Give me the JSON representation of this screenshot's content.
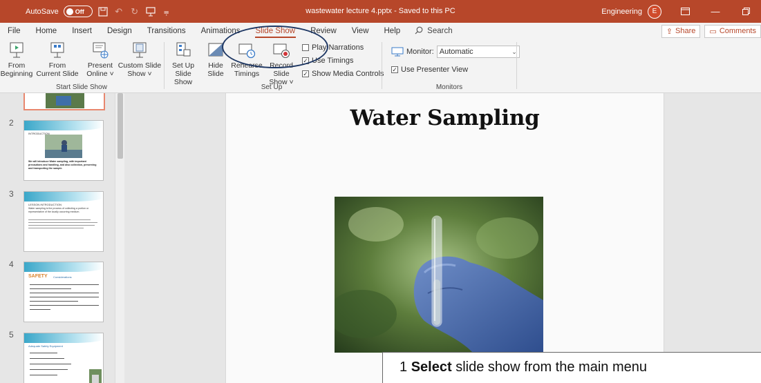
{
  "titlebar": {
    "autosave_label": "AutoSave",
    "autosave_state": "Off",
    "doc_title": "wastewater lecture 4.pptx  -  Saved to this PC",
    "user_name": "Engineering",
    "user_initial": "E"
  },
  "menu": {
    "tabs": [
      "File",
      "Home",
      "Insert",
      "Design",
      "Transitions",
      "Animations",
      "Slide Show",
      "Review",
      "View",
      "Help"
    ],
    "active_tab": "Slide Show",
    "search_label": "Search",
    "share_label": "Share",
    "comments_label": "Comments"
  },
  "ribbon": {
    "start_group": {
      "label": "Start Slide Show",
      "from_beginning": [
        "From",
        "Beginning"
      ],
      "from_current": [
        "From",
        "Current Slide"
      ],
      "present_online": [
        "Present",
        "Online ˅"
      ],
      "custom_show": [
        "Custom Slide",
        "Show ˅"
      ]
    },
    "setup_group": {
      "label": "Set Up",
      "setup_show": [
        "Set Up",
        "Slide Show"
      ],
      "hide_slide": [
        "Hide",
        "Slide"
      ],
      "rehearse": [
        "Rehearse",
        "Timings"
      ],
      "record": [
        "Record Slide",
        "Show ˅"
      ],
      "play_narrations": "Play Narrations",
      "use_timings": "Use Timings",
      "show_media_controls": "Show Media Controls"
    },
    "monitors_group": {
      "label": "Monitors",
      "monitor_label": "Monitor:",
      "monitor_value": "Automatic",
      "presenter_view": "Use Presenter View"
    }
  },
  "thumbnails": {
    "numbers": [
      "2",
      "3",
      "4",
      "5"
    ],
    "slide2": {
      "heading": "INTRODUCTION",
      "body": "We will introduce Water sampling, with important precautions and handling, and also collection, preserving and transporting the sample."
    },
    "slide3": {
      "heading": "LESSON INTRODUCTION",
      "body": "Water sampling is the process of collecting a portion or representative of the locally occurring medium."
    },
    "slide4": {
      "heading": "SAFETY",
      "sub": "Considerations"
    },
    "slide5": {
      "heading": "Adequate Safety Equipment"
    }
  },
  "slide": {
    "title": "Water Sampling"
  },
  "caption": {
    "number": "1",
    "bold": "Select",
    "rest": "slide show from the main menu"
  },
  "colors": {
    "accent": "#b7472a",
    "annotation_circle": "#1f3864"
  }
}
